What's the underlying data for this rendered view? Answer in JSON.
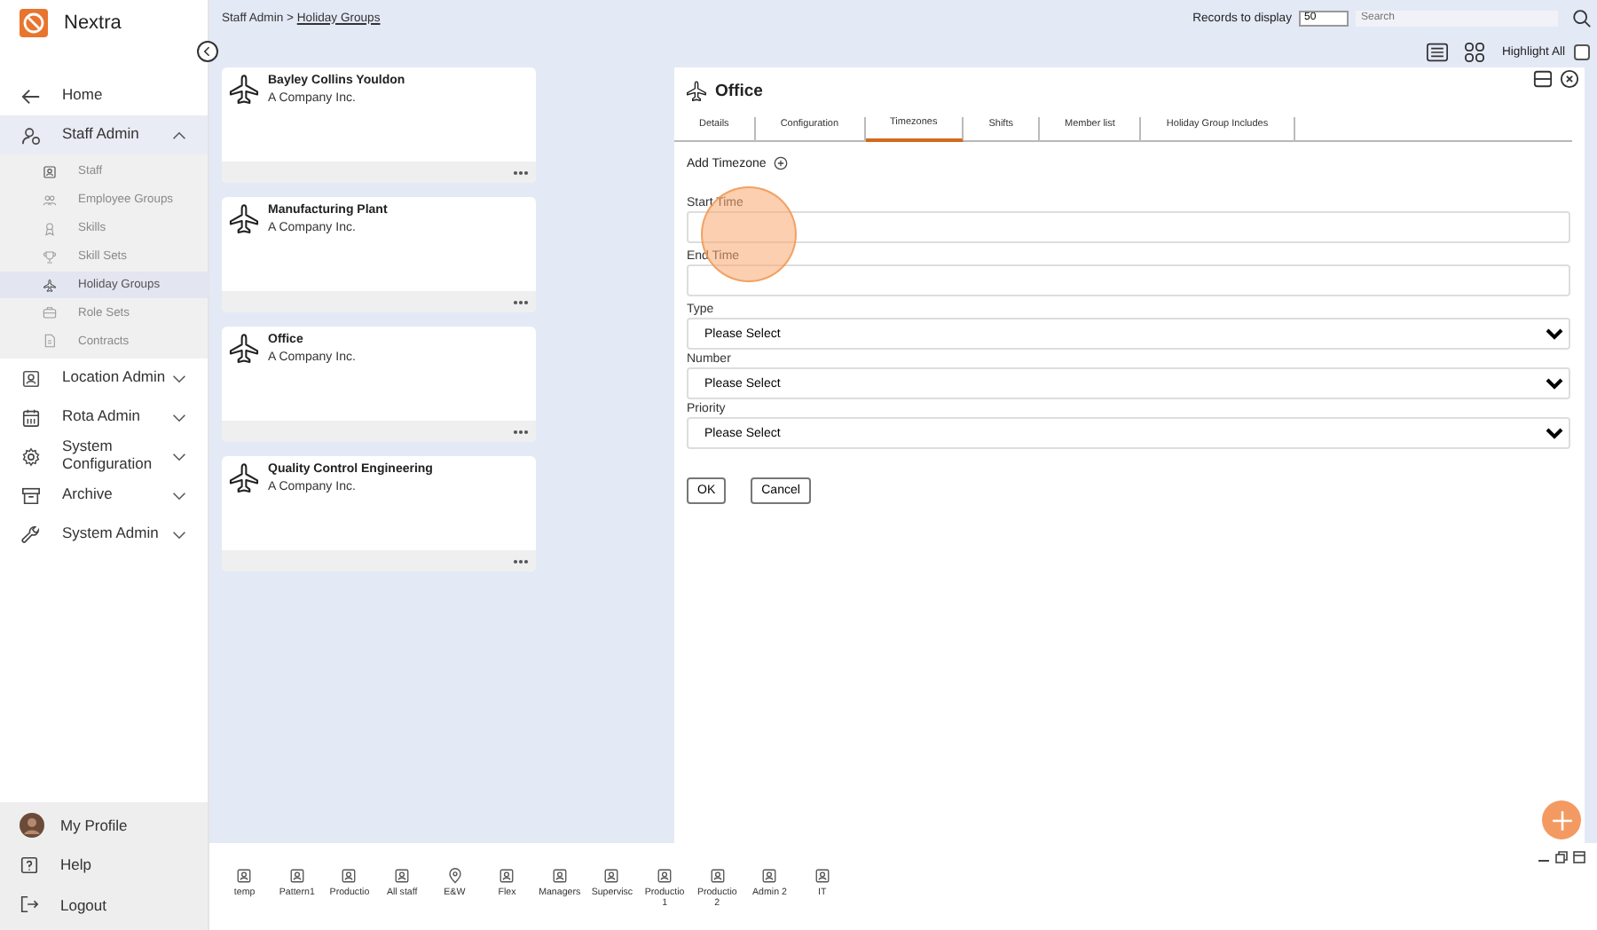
{
  "app": {
    "name": "Nextra"
  },
  "sidebar": {
    "items": [
      {
        "label": "Home",
        "kind": "back"
      },
      {
        "label": "Staff Admin",
        "kind": "staff",
        "expanded": true,
        "children": [
          {
            "label": "Staff",
            "kind": "person",
            "selected": false
          },
          {
            "label": "Employee Groups",
            "kind": "group",
            "selected": false
          },
          {
            "label": "Skills",
            "kind": "skill",
            "selected": false
          },
          {
            "label": "Skill Sets",
            "kind": "trophy",
            "selected": false
          },
          {
            "label": "Holiday Groups",
            "kind": "plane",
            "selected": true
          },
          {
            "label": "Role Sets",
            "kind": "case",
            "selected": false
          },
          {
            "label": "Contracts",
            "kind": "doc",
            "selected": false
          }
        ]
      },
      {
        "label": "Location Admin",
        "kind": "person",
        "expanded": false
      },
      {
        "label": "Rota Admin",
        "kind": "calendar",
        "expanded": false
      },
      {
        "label": "System Configuration",
        "kind": "gear",
        "expanded": false
      },
      {
        "label": "Archive",
        "kind": "archive",
        "expanded": false
      },
      {
        "label": "System Admin",
        "kind": "wrench",
        "expanded": false
      }
    ],
    "footer": [
      {
        "label": "My Profile",
        "kind": "avatar"
      },
      {
        "label": "Help",
        "kind": "help"
      },
      {
        "label": "Logout",
        "kind": "logout"
      }
    ]
  },
  "breadcrumb": {
    "parent": "Staff Admin",
    "separator": ">",
    "current": "Holiday Groups"
  },
  "toolbar": {
    "records_label": "Records to display",
    "records_value": "50",
    "search": {
      "placeholder": "Search"
    },
    "highlight_all": {
      "label": "Highlight All",
      "checked": false
    }
  },
  "cards": [
    {
      "title": "Bayley Collins Youldon",
      "subtitle": "A Company Inc."
    },
    {
      "title": "Manufacturing Plant",
      "subtitle": "A Company Inc."
    },
    {
      "title": "Office",
      "subtitle": "A Company Inc."
    },
    {
      "title": "Quality Control Engineering",
      "subtitle": "A Company Inc."
    }
  ],
  "panel": {
    "title": "Office",
    "tabs": [
      {
        "label": "Details",
        "selected": false
      },
      {
        "label": "Configuration",
        "selected": false
      },
      {
        "label": "Timezones",
        "selected": true
      },
      {
        "label": "Shifts",
        "selected": false
      },
      {
        "label": "Member list",
        "selected": false
      },
      {
        "label": "Holiday Group Includes",
        "selected": false
      }
    ],
    "add_label": "Add Timezone",
    "fields": [
      {
        "label": "Start Time",
        "kind": "text"
      },
      {
        "label": "End Time",
        "kind": "text"
      },
      {
        "label": "Type",
        "kind": "select",
        "value": "Please Select"
      },
      {
        "label": "Number",
        "kind": "select",
        "value": "Please Select"
      },
      {
        "label": "Priority",
        "kind": "select",
        "value": "Please Select"
      }
    ],
    "buttons": [
      "OK",
      "Cancel"
    ]
  },
  "bottom_bar": [
    {
      "label": "temp",
      "kind": "person"
    },
    {
      "label": "Pattern1",
      "kind": "person"
    },
    {
      "label": "Productio",
      "kind": "person"
    },
    {
      "label": "All staff",
      "kind": "person"
    },
    {
      "label": "E&W",
      "kind": "pin"
    },
    {
      "label": "Flex",
      "kind": "person"
    },
    {
      "label": "Managers",
      "kind": "person"
    },
    {
      "label": "Supervisc",
      "kind": "person"
    },
    {
      "label": "Productio 1",
      "kind": "person"
    },
    {
      "label": "Productio 2",
      "kind": "person"
    },
    {
      "label": "Admin 2",
      "kind": "person"
    },
    {
      "label": "IT",
      "kind": "person"
    }
  ]
}
